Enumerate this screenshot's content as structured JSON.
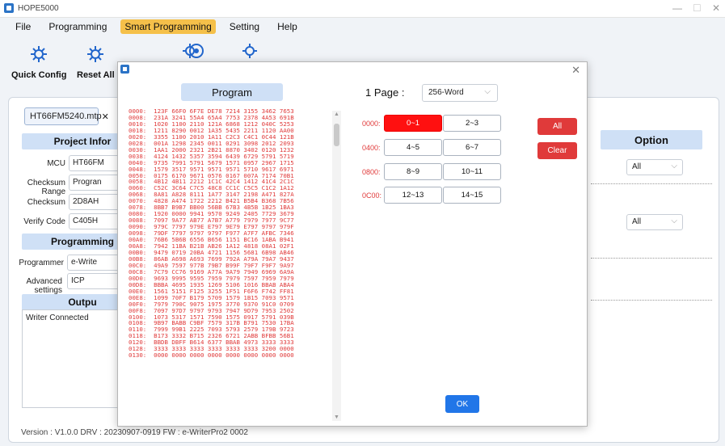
{
  "window": {
    "title": "HOPE5000",
    "minimize": "—",
    "maximize": "☐",
    "close": "✕"
  },
  "menu": [
    "File",
    "Programming",
    "Smart Programming",
    "Setting",
    "Help"
  ],
  "toolbar": {
    "quick_config": "Quick Config",
    "reset_all": "Reset All"
  },
  "file_tab": {
    "name": "HT66FM5240.mtp",
    "close": "✕"
  },
  "project_info": {
    "title": "Project Infor",
    "mcu_label": "MCU",
    "mcu_value": "HT66FM",
    "checksum_range_label": "Checksum Range",
    "checksum_range_value": "Progran",
    "checksum_label": "Checksum",
    "checksum_value": "2D8AH",
    "verify_code_label": "Verify Code",
    "verify_code_value": "C405H"
  },
  "programming": {
    "title": "Programming",
    "programmer_label": "Programmer",
    "programmer_value": "e-Write",
    "advanced_label": "Advanced settings",
    "advanced_value": "ICP"
  },
  "output": {
    "title": "Outpu",
    "text": "Writer Connected"
  },
  "option": {
    "title": "Option",
    "select1": "All",
    "select2": "All"
  },
  "status": {
    "text": "Version : V1.0.0    DRV : 20230907-0919    FW : e-WriterPro2 0002"
  },
  "dialog": {
    "program_title": "Program",
    "page_label": "1 Page :",
    "page_value": "256-Word",
    "hex_lines": [
      "0000:  123F 66F0 6F7E DE78 7214 3155 3462 7653",
      "0008:  231A 3241 55A4 65A4 7753 2378 4A53 691B",
      "0010:  1020 1100 2110 121A 6868 1212 040C 5253",
      "0018:  1211 8290 0012 1A35 5435 2211 1120 AA00",
      "0020:  3355 1100 2010 1A11 C2C3 C4C1 0C44 121B",
      "0028:  001A 1298 2345 0011 0291 3098 2012 2093",
      "0030:  1AA1 2000 2321 2B21 8870 3402 0120 1232",
      "0038:  4124 1432 5357 3594 6439 6729 5791 5719",
      "0040:  9735 7991 5791 5679 1571 0957 2967 1715",
      "0048:  1579 3517 9571 9571 9571 5710 9617 6971",
      "0050:  0175 6170 9671 0576 0167 007A 7174 70B1",
      "0058:  4B12 4B11 2212 1C1C 42C4 1412 41C4 2C1C",
      "0060:  C52C 3C64 C7C5 48C8 CC1C C5C5 C1C2 1A12",
      "0068:  8A81 A828 8111 1A77 3147 2198 A471 827A",
      "0070:  4828 A474 1722 2212 B421 B5B4 B368 7B56",
      "0078:  8BB7 B9B7 BB00 56BB 67B3 4B5B 1B25 1BA3",
      "0080:  1920 0000 9941 9570 9249 2405 7729 3679",
      "0088:  7097 9A77 AB77 A7B7 A779 7979 7977 9C77",
      "0090:  979C 7797 979E E797 9E79 E797 9797 979F",
      "0098:  79DF 7797 9797 9797 F977 A7F7 AFBC 7346",
      "00A0:  76B6 5B6B 6556 B656 1151 BC16 1ABA B941",
      "00A8:  7942 11BA B21B AB26 1A12 4818 08A1 02F1",
      "00B0:  9479 0719 20BA 4721 1156 5681 6B98 AB46",
      "00B8:  86AB A698 A693 7699 792A A79A 79A7 9437",
      "00C0:  49A9 7597 977B 79B7 B99F 79F7 F9F7 9A97",
      "00C8:  7C79 CC76 9169 A77A 9A79 7949 6969 6A9A",
      "00D0:  9693 9995 9595 7959 7979 7597 7959 7979",
      "00D8:  BBBA 4695 1935 1269 5106 1016 BBAB ABA4",
      "00E0:  1561 5151 F125 3255 1F51 F6F6 F742 FF81",
      "00E8:  1099 70F7 B179 5709 1579 1B15 7093 9571",
      "00F0:  7979 790C 9075 1975 3770 9370 91C0 0709",
      "00F8:  7097 97D7 9797 9793 7947 9D79 7953 2502",
      "0100:  1073 5317 1571 7590 1575 0917 5791 039B",
      "0108:  9B97 BABB C9BF 7579 317B B791 7530 17BA",
      "0110:  7999 99B1 2225 7093 5793 2579 179B 9723",
      "0118:  B173 3332 B715 2326 6721 2ABB BFBB 56B1",
      "0120:  BBDB DBFF B614 6377 BBAB 4973 3333 3333",
      "0128:  3333 3333 3333 3333 3333 3333 3200 0000",
      "0130:  0000 0000 0000 0000 0000 0000 0000 0000"
    ],
    "rows": [
      {
        "addr": "0000:",
        "left": "0~1",
        "right": "2~3"
      },
      {
        "addr": "0400:",
        "left": "4~5",
        "right": "6~7"
      },
      {
        "addr": "0800:",
        "left": "8~9",
        "right": "10~11"
      },
      {
        "addr": "0C00:",
        "left": "12~13",
        "right": "14~15"
      }
    ],
    "all_button": "All",
    "clear_button": "Clear",
    "ok_button": "OK",
    "close": "✕"
  }
}
